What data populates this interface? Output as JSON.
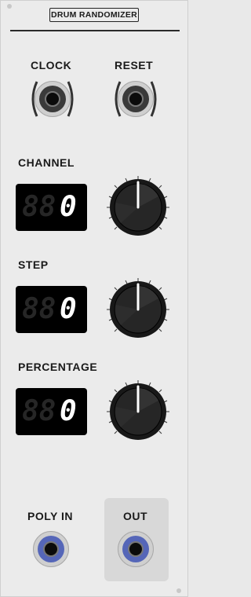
{
  "module": {
    "title": "DRUM RANDOMIZER"
  },
  "inputs": {
    "clock_label": "CLOCK",
    "reset_label": "RESET"
  },
  "controls": {
    "channel": {
      "label": "CHANNEL",
      "ghost": "88",
      "value": "0"
    },
    "step": {
      "label": "STEP",
      "ghost": "88",
      "value": "0"
    },
    "percentage": {
      "label": "PERCENTAGE",
      "ghost": "88",
      "value": "0"
    }
  },
  "outputs": {
    "poly_in_label": "POLY IN",
    "out_label": "OUT"
  },
  "colors": {
    "panel": "#ebebeb",
    "display_bg": "#000000",
    "jack_accent": "#5566b8"
  }
}
